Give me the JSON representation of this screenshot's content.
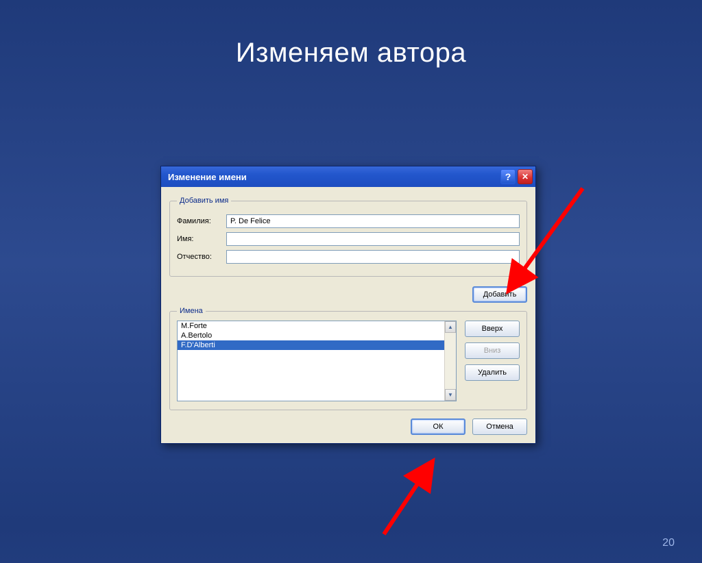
{
  "slide": {
    "title": "Изменяем автора",
    "page_number": "20"
  },
  "dialog": {
    "title": "Изменение имени",
    "add_group": {
      "legend": "Добавить имя",
      "surname_label": "Фамилия:",
      "surname_value": "P. De Felice",
      "firstname_label": "Имя:",
      "firstname_value": "",
      "patronymic_label": "Отчество:",
      "patronymic_value": ""
    },
    "add_button": "Добавить",
    "names_group": {
      "legend": "Имена",
      "items": [
        "M.Forte",
        "A.Bertolo",
        "F.D'Alberti"
      ],
      "selected_index": 2
    },
    "up_button": "Вверх",
    "down_button": "Вниз",
    "delete_button": "Удалить",
    "ok_button": "ОК",
    "cancel_button": "Отмена"
  }
}
